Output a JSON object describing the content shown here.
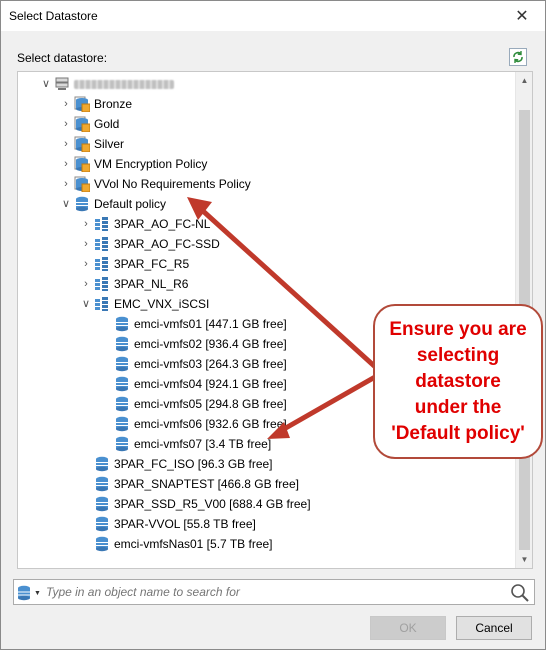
{
  "window": {
    "title": "Select Datastore"
  },
  "section_label": "Select datastore:",
  "tree": {
    "root": {
      "label": ""
    },
    "policies": [
      {
        "label": "Bronze",
        "icon": "storage-policy-icon"
      },
      {
        "label": "Gold",
        "icon": "storage-policy-icon"
      },
      {
        "label": "Silver",
        "icon": "storage-policy-icon"
      },
      {
        "label": "VM Encryption Policy",
        "icon": "storage-policy-icon"
      },
      {
        "label": "VVol No Requirements Policy",
        "icon": "storage-policy-icon"
      }
    ],
    "default_policy": {
      "label": "Default policy"
    },
    "clusters": [
      {
        "label": "3PAR_AO_FC-NL"
      },
      {
        "label": "3PAR_AO_FC-SSD"
      },
      {
        "label": "3PAR_FC_R5"
      },
      {
        "label": "3PAR_NL_R6"
      },
      {
        "label": "EMC_VNX_iSCSI"
      }
    ],
    "emc_datastores": [
      {
        "label": "emci-vmfs01 [447.1 GB free]"
      },
      {
        "label": "emci-vmfs02 [936.4 GB free]"
      },
      {
        "label": "emci-vmfs03 [264.3 GB free]"
      },
      {
        "label": "emci-vmfs04 [924.1 GB free]"
      },
      {
        "label": "emci-vmfs05 [294.8 GB free]"
      },
      {
        "label": "emci-vmfs06 [932.6 GB free]"
      },
      {
        "label": "emci-vmfs07 [3.4 TB free]"
      }
    ],
    "datastores": [
      {
        "label": "3PAR_FC_ISO [96.3 GB free]"
      },
      {
        "label": "3PAR_SNAPTEST [466.8 GB free]"
      },
      {
        "label": "3PAR_SSD_R5_V00 [688.4 GB free]"
      },
      {
        "label": "3PAR-VVOL [55.8 TB free]"
      },
      {
        "label": "emci-vmfsNas01 [5.7 TB free]"
      }
    ]
  },
  "search": {
    "placeholder": "Type in an object name to search for"
  },
  "buttons": {
    "ok": "OK",
    "cancel": "Cancel"
  },
  "callout": {
    "text": "Ensure you are selecting datastore under the 'Default policy'"
  },
  "colors": {
    "callout_border": "#b24a3a",
    "callout_text": "#e00000",
    "arrow": "#c0392b",
    "policy_icon": "#f0a830",
    "datastore_icon": "#4a90d0"
  }
}
